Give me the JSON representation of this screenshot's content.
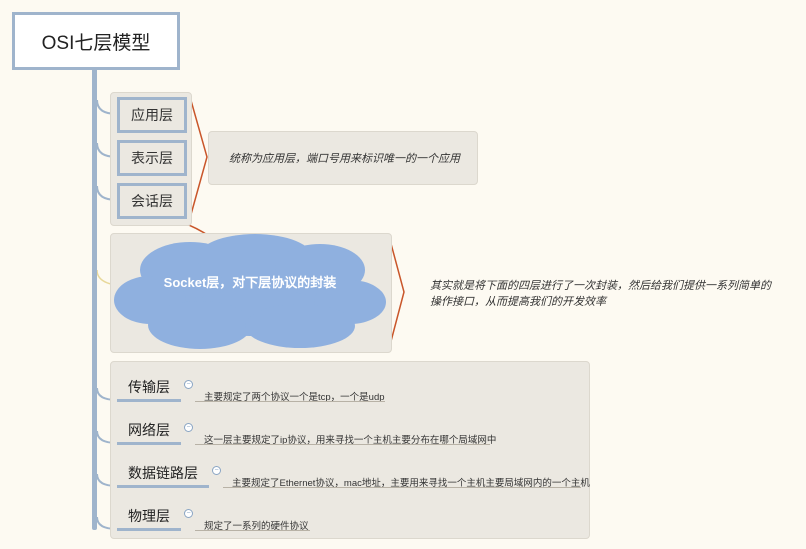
{
  "title": "OSI七层模型",
  "upper_layers": [
    {
      "label": "应用层"
    },
    {
      "label": "表示层"
    },
    {
      "label": "会话层"
    }
  ],
  "upper_note": "统称为应用层，端口号用来标识唯一的一个应用",
  "socket": {
    "label": "Socket层，对下层协议的封装",
    "note_line1": "其实就是将下面的四层进行了一次封装，然后给我们提供一系列简单的",
    "note_line2": "操作接口，从而提高我们的开发效率"
  },
  "lower_layers": [
    {
      "label": "传输层",
      "desc": "主要规定了两个协议一个是tcp，一个是udp"
    },
    {
      "label": "网络层",
      "desc": "这一层主要规定了ip协议，用来寻找一个主机主要分布在哪个局域网中"
    },
    {
      "label": "数据链路层",
      "desc": "主要规定了Ethernet协议，mac地址，主要用来寻找一个主机主要局域网内的一个主机"
    },
    {
      "label": "物理层",
      "desc": "规定了一系列的硬件协议"
    }
  ],
  "colors": {
    "trunk": "#9fb4cc",
    "bracket": "#c9562a",
    "cloud": "#8fb0df",
    "group_bg": "#ebe8e1"
  }
}
